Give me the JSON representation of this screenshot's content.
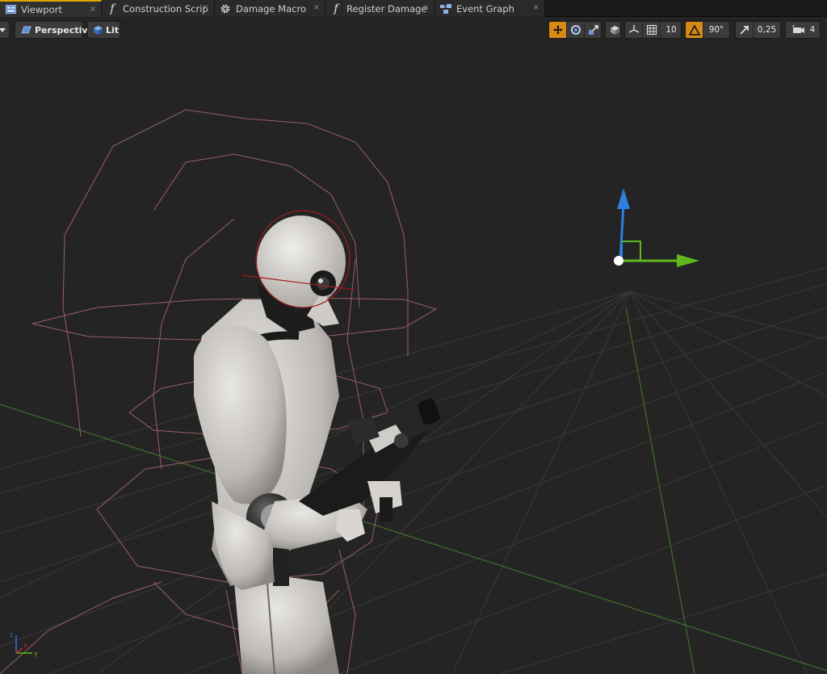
{
  "tabs": [
    {
      "label": "Viewport",
      "icon": "viewport-icon",
      "active": true
    },
    {
      "label": "Construction Scrip",
      "icon": "function-icon"
    },
    {
      "label": "Damage Macro",
      "icon": "macro-gear-icon"
    },
    {
      "label": "Register Damage",
      "icon": "function-icon"
    },
    {
      "label": "Event Graph",
      "icon": "event-graph-icon"
    }
  ],
  "tab_close_glyph": "×",
  "function_glyph": "f",
  "viewport_toolbar": {
    "perspective_label": "Perspective",
    "lit_label": "Lit"
  },
  "right_toolbar": {
    "grid_snap_value": "10",
    "rotation_snap_value": "90°",
    "scale_snap_value": "0,25",
    "camera_speed_value": "4"
  },
  "axis_indicator": {
    "x_label": "x",
    "y_label": "y",
    "z_label": "z"
  },
  "colors": {
    "background": "#242424",
    "accent": "#d98a12",
    "gizmo_x": "#5fb81f",
    "gizmo_z": "#2e7fe0",
    "collision_wire": "#b06a72"
  }
}
